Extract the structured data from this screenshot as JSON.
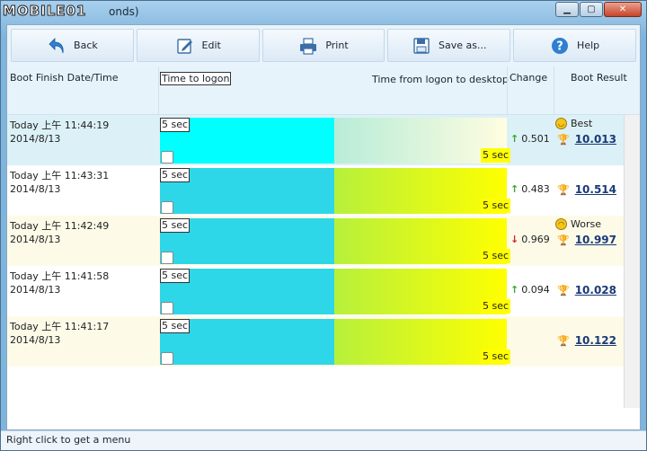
{
  "window": {
    "title_logo": "MOBILE01",
    "title_suffix": "onds)",
    "buttons": {
      "minimize": "▁",
      "maximize": "▢",
      "close": "✕"
    }
  },
  "toolbar": {
    "buttons": [
      {
        "label": "Back",
        "icon": "back-arrow-icon"
      },
      {
        "label": "Edit",
        "icon": "edit-icon"
      },
      {
        "label": "Print",
        "icon": "printer-icon"
      },
      {
        "label": "Save as...",
        "icon": "floppy-disk-icon"
      },
      {
        "label": "Help",
        "icon": "help-icon"
      }
    ]
  },
  "table": {
    "headers": {
      "boot_finish": "Boot Finish Date/Time",
      "time_to_logon": "Time to logon",
      "time_to_desktop": "Time from logon to desktop",
      "change": "Change",
      "boot_result": "Boot Result"
    },
    "rows": [
      {
        "time": "Today  上午 11:44:19",
        "date": "2014/8/13",
        "logon_label": "5 sec",
        "desktop_label": "5 sec",
        "change": "0.501",
        "direction": "up",
        "note": "Best",
        "result": "10.013"
      },
      {
        "time": "Today  上午 11:43:31",
        "date": "2014/8/13",
        "logon_label": "5 sec",
        "desktop_label": "5 sec",
        "change": "0.483",
        "direction": "up",
        "note": "",
        "result": "10.514"
      },
      {
        "time": "Today  上午 11:42:49",
        "date": "2014/8/13",
        "logon_label": "5 sec",
        "desktop_label": "5 sec",
        "change": "0.969",
        "direction": "down",
        "note": "Worse",
        "result": "10.997"
      },
      {
        "time": "Today  上午 11:41:58",
        "date": "2014/8/13",
        "logon_label": "5 sec",
        "desktop_label": "5 sec",
        "change": "0.094",
        "direction": "up",
        "note": "",
        "result": "10.028"
      },
      {
        "time": "Today  上午 11:41:17",
        "date": "2014/8/13",
        "logon_label": "5 sec",
        "desktop_label": "5 sec",
        "change": "",
        "direction": "",
        "note": "",
        "result": "10.122"
      }
    ]
  },
  "status": {
    "text": "Right click to get a menu"
  },
  "colors": {
    "row_selected": "#dcf1f7",
    "row_white": "#ffffff",
    "row_cream": "#fdfbe8",
    "logon_bar": "#2ed7e8",
    "logon_bar_selected": "#00ffff"
  }
}
